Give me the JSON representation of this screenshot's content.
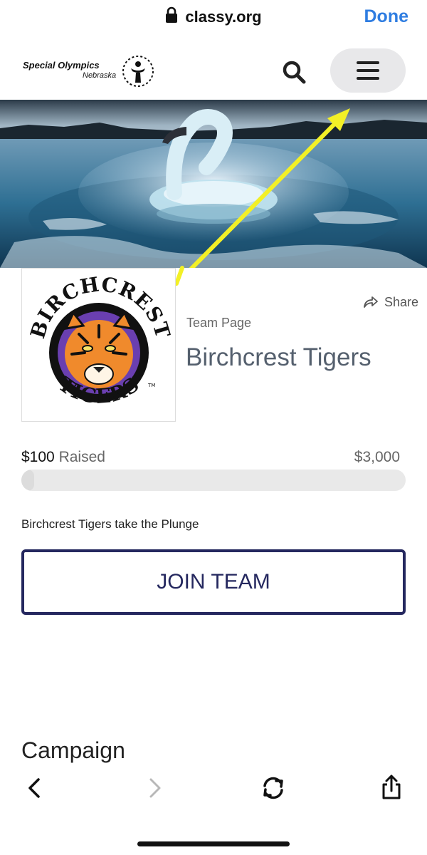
{
  "browser": {
    "url": "classy.org",
    "done_label": "Done"
  },
  "header": {
    "logo_title": "Special Olympics",
    "logo_subtitle": "Nebraska",
    "icons": [
      "search-icon",
      "menu-icon"
    ]
  },
  "team": {
    "page_type": "Team Page",
    "name": "Birchcrest Tigers",
    "share_label": "Share",
    "logo_text_top": "BIRCHCREST",
    "logo_text_bottom": "TIGERS",
    "logo_tm": "TM"
  },
  "fundraising": {
    "raised_amount": "$100",
    "raised_label": "Raised",
    "goal": "$3,000",
    "progress_fraction": 0.033
  },
  "description": "Birchcrest Tigers take the Plunge",
  "join_button": "JOIN TEAM",
  "campaign_heading": "Campaign",
  "toolbar": {
    "icons": [
      "back-icon",
      "forward-icon",
      "reload-icon",
      "share-icon"
    ]
  },
  "colors": {
    "accent": "#2f7de1",
    "button_navy": "#25285f",
    "arrow_yellow": "#f3f026"
  }
}
